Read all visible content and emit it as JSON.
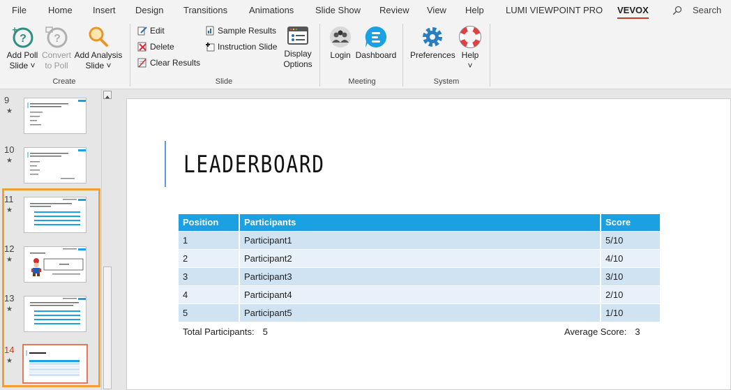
{
  "menu": {
    "tabs": [
      "File",
      "Home",
      "Insert",
      "Design",
      "Transitions",
      "Animations",
      "Slide Show",
      "Review",
      "View",
      "Help",
      "LUMI VIEWPOINT PRO",
      "VEVOX"
    ],
    "search_label": "Search"
  },
  "ribbon": {
    "create": {
      "label": "Create",
      "add_poll_1": "Add Poll",
      "add_poll_2": "Slide ˅",
      "convert_1": "Convert",
      "convert_2": "to Poll",
      "add_analysis_1": "Add Analysis",
      "add_analysis_2": "Slide ˅"
    },
    "slide": {
      "label": "Slide",
      "edit": "Edit",
      "delete": "Delete",
      "clear_results": "Clear Results",
      "sample_results": "Sample Results",
      "instruction_slide": "Instruction Slide",
      "display_1": "Display",
      "display_2": "Options"
    },
    "meeting": {
      "label": "Meeting",
      "login": "Login",
      "dashboard": "Dashboard"
    },
    "system": {
      "label": "System",
      "preferences": "Preferences",
      "help": "Help",
      "help_caret": "˅"
    }
  },
  "thumbnails": [
    {
      "num": "9",
      "star": "★"
    },
    {
      "num": "10",
      "star": "★"
    },
    {
      "num": "11",
      "star": "★"
    },
    {
      "num": "12",
      "star": "★"
    },
    {
      "num": "13",
      "star": "★"
    },
    {
      "num": "14",
      "star": "★"
    }
  ],
  "slide": {
    "title": "LEADERBOARD",
    "table": {
      "headers": [
        "Position",
        "Participants",
        "Score"
      ],
      "rows": [
        [
          "1",
          "Participant1",
          "5/10"
        ],
        [
          "2",
          "Participant2",
          "4/10"
        ],
        [
          "3",
          "Participant3",
          "3/10"
        ],
        [
          "4",
          "Participant4",
          "2/10"
        ],
        [
          "5",
          "Participant5",
          "1/10"
        ]
      ]
    },
    "total_label": "Total Participants:",
    "total_value": "5",
    "avg_label": "Average Score:",
    "avg_value": "3"
  },
  "colors": {
    "accent": "#1ba1e2",
    "vevox_underline": "#c43e1c",
    "selection": "#f0a030",
    "current_thumb": "#e8765a"
  }
}
